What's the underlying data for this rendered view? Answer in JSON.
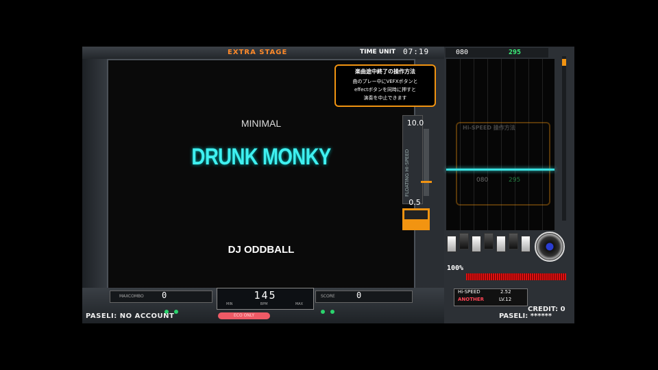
{
  "header": {
    "stage": "EXTRA STAGE",
    "time_label": "TIME UNIT",
    "time_value": "07:19"
  },
  "song": {
    "genre": "MINIMAL",
    "title": "DRUNK MONKY",
    "artist": "DJ ODDBALL"
  },
  "notice": {
    "title": "楽曲途中終了の操作方法",
    "body_line1": "曲のプレー中にVEFXボタンと",
    "body_line2": "effectボタンを同時に押すと",
    "body_line3": "演奏を中止できます"
  },
  "hispeed_slider": {
    "label": "FLOATING HI-SPEED",
    "max": "10.0",
    "min": "0.5"
  },
  "bottom": {
    "maxcombo_label": "MAXCOMBO",
    "maxcombo_value": "0",
    "score_label": "SCORE",
    "score_value": "0",
    "bpm_value": "145",
    "bpm_labels": [
      "MIN",
      "BPM",
      "MAX"
    ],
    "red_pill": "ECO ONLY",
    "pasel_left": "PASELI: NO ACCOUNT",
    "pasel_right": "PASELI: ******",
    "credit": "CREDIT: 0"
  },
  "playfield": {
    "top_white": "080",
    "top_green": "295",
    "ghost_title": "Hi-SPEED 操作方法",
    "ghost_white": "080",
    "ghost_green": "295",
    "gauge_label": "100%",
    "hispeed_label": "Hi-SPEED",
    "hispeed_value": "2.52",
    "difficulty": "ANOTHER",
    "level": "LV.12"
  }
}
